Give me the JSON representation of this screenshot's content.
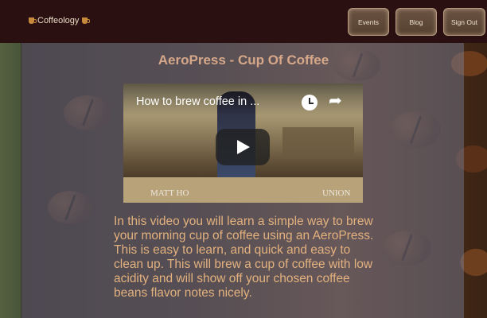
{
  "header": {
    "brand": "Coffeology",
    "nav": [
      {
        "label": "Events"
      },
      {
        "label": "Blog"
      },
      {
        "label": "Sign Out"
      }
    ]
  },
  "main": {
    "title": "AeroPress - Cup Of Coffee",
    "video": {
      "title": "How to brew coffee in ...",
      "watermark_left": "MATT HO",
      "watermark_right": "UNION"
    },
    "description": "In this video you will learn a simple way to brew your morning cup of coffee using an AeroPress. This is easy to learn, and quick and easy to clean up. This will brew a cup of coffee with low acidity and will show off your chosen coffee beans flavor notes nicely."
  },
  "colors": {
    "header_bg": "#2a1010",
    "title": "#d6a88a",
    "description": "#e3b17e",
    "nav_text": "#f0e2cf"
  }
}
